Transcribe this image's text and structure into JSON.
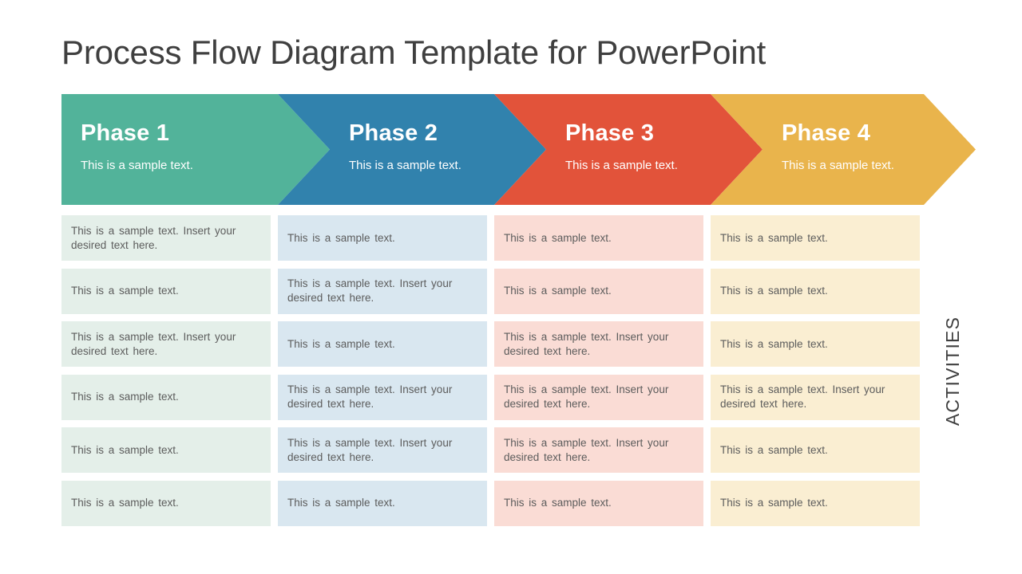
{
  "slide": {
    "title": "Process Flow Diagram Template for PowerPoint",
    "background_color": "#ffffff"
  },
  "banner": {
    "phases": [
      {
        "title": "Phase 1",
        "subtitle": "This is a sample text.",
        "color": "#52b39a"
      },
      {
        "title": "Phase 2",
        "subtitle": "This is a sample text.",
        "color": "#3182ad"
      },
      {
        "title": "Phase 3",
        "subtitle": "This is a sample text.",
        "color": "#e2533a"
      },
      {
        "title": "Phase 4",
        "subtitle": "This is a sample text.",
        "color": "#e9b44c"
      }
    ]
  },
  "activities": {
    "side_label": "ACTIVITIES",
    "column_colors": [
      "#e4efe9",
      "#d9e7f0",
      "#fadcd5",
      "#faeed2"
    ],
    "text_color": "#5c5c5c",
    "short_text": "This is a sample text.",
    "long_text": "This is a sample text. Insert your desired text here.",
    "rows": [
      [
        "This is a sample text. Insert your desired text here.",
        "This is a sample text.",
        "This is a sample text.",
        "This is a sample text."
      ],
      [
        "This is a sample text.",
        "This is a sample text. Insert your desired text here.",
        "This is a sample text.",
        "This is a sample text."
      ],
      [
        "This is a sample text. Insert your desired text here.",
        "This is a sample text.",
        "This is a sample text. Insert your desired text here.",
        "This is a sample text."
      ],
      [
        "This is a sample text.",
        "This is a sample text. Insert your desired text here.",
        "This is a sample text. Insert your desired text here.",
        "This is a sample text. Insert your desired text here."
      ],
      [
        "This is a sample text.",
        "This is a sample text. Insert your desired text here.",
        "This is a sample text. Insert your desired text here.",
        "This is a sample text."
      ],
      [
        "This is a sample text.",
        "This is a sample text.",
        "This is a sample text.",
        "This is a sample text."
      ]
    ]
  }
}
